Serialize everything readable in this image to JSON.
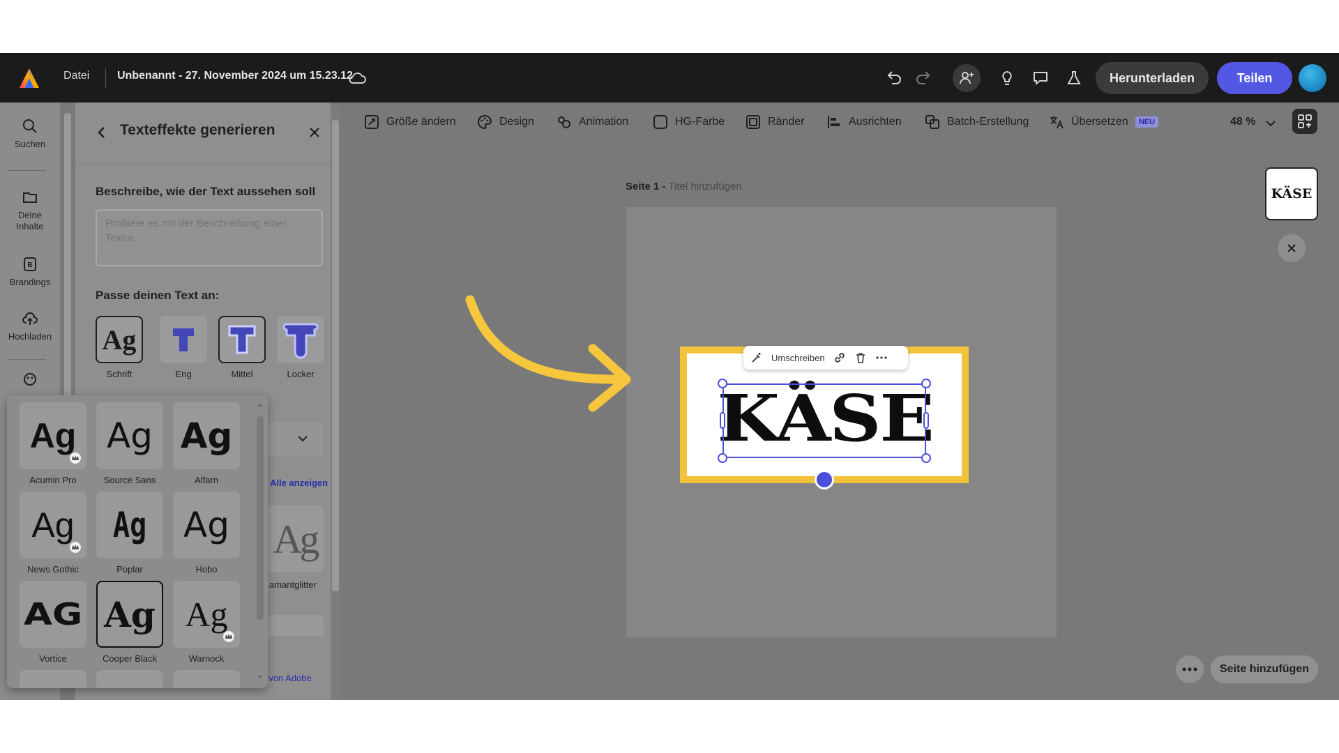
{
  "topbar": {
    "file_menu": "Datei",
    "document_title": "Unbenannt - 27. November 2024 um 15.23.12",
    "download_label": "Herunterladen",
    "share_label": "Teilen"
  },
  "rail": {
    "items": [
      {
        "label": "Suchen",
        "icon": "search-icon"
      },
      {
        "label": "Deine Inhalte",
        "icon": "folder-icon"
      },
      {
        "label": "Brandings",
        "icon": "brand-icon"
      },
      {
        "label": "Hochladen",
        "icon": "upload-icon"
      }
    ]
  },
  "panel": {
    "title": "Texteffekte generieren",
    "describe_label": "Beschreibe, wie der Text aussehen soll",
    "describe_placeholder": "Probiere es mit der Beschreibung einer Textur.",
    "adapt_label": "Passe deinen Text an:",
    "fit_options": [
      {
        "label": "Schrift",
        "glyph": "Ag",
        "selected": true
      },
      {
        "label": "Eng",
        "glyph": "T",
        "selected": false
      },
      {
        "label": "Mittel",
        "glyph": "T",
        "selected": true
      },
      {
        "label": "Locker",
        "glyph": "T",
        "selected": false
      }
    ],
    "show_all": "Alle anzeigen",
    "partial_effect_label": "amantglitter",
    "footer_link": "Benutzungsrichtlinien zur generativen KI von Adobe"
  },
  "font_popover": {
    "fonts": [
      {
        "label": "Acumin Pro",
        "glyph": "Ag",
        "premium": true,
        "selected": false
      },
      {
        "label": "Source Sans",
        "glyph": "Ag",
        "premium": false,
        "selected": false
      },
      {
        "label": "Alfarn",
        "glyph": "Ag",
        "premium": false,
        "selected": false
      },
      {
        "label": "News Gothic",
        "glyph": "Ag",
        "premium": true,
        "selected": false
      },
      {
        "label": "Poplar",
        "glyph": "Ag",
        "premium": false,
        "selected": false
      },
      {
        "label": "Hobo",
        "glyph": "Ag",
        "premium": false,
        "selected": false
      },
      {
        "label": "Vortice",
        "glyph": "AG",
        "premium": false,
        "selected": false
      },
      {
        "label": "Cooper Black",
        "glyph": "Ag",
        "premium": false,
        "selected": true
      },
      {
        "label": "Warnock",
        "glyph": "Ag",
        "premium": true,
        "selected": false
      }
    ]
  },
  "canvas_toolbar": {
    "items": [
      {
        "label": "Größe ändern",
        "icon": "resize-icon"
      },
      {
        "label": "Design",
        "icon": "palette-icon"
      },
      {
        "label": "Animation",
        "icon": "animation-icon"
      },
      {
        "label": "HG-Farbe",
        "icon": "bg-color-icon"
      },
      {
        "label": "Ränder",
        "icon": "border-icon"
      },
      {
        "label": "Ausrichten",
        "icon": "align-icon"
      },
      {
        "label": "Batch-Erstellung",
        "icon": "batch-icon"
      },
      {
        "label": "Übersetzen",
        "icon": "translate-icon"
      }
    ],
    "new_badge": "NEU",
    "zoom": "48 %"
  },
  "canvas": {
    "page_label": "Seite 1 -",
    "page_title_placeholder": "Titel hinzufügen",
    "text_element": "KÄSE",
    "context_action": "Umschreiben",
    "thumbnail_text": "KÄSE",
    "add_page": "Seite hinzufügen"
  },
  "colors": {
    "accent": "#5258e4",
    "frame_yellow": "#f2c23b",
    "arrow_yellow": "#f6c63d",
    "topbar": "#1b1b1b"
  }
}
